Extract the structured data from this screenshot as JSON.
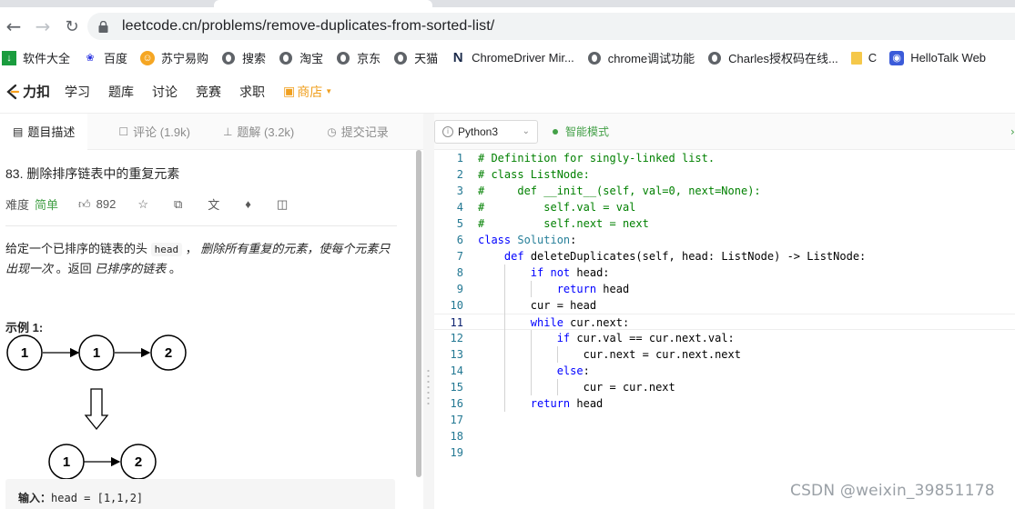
{
  "browser": {
    "url": "leetcode.cn/problems/remove-duplicates-from-sorted-list/"
  },
  "bookmarks": [
    {
      "label": "软件大全",
      "icon": "download-icon",
      "color": "#1a9c3e"
    },
    {
      "label": "百度",
      "icon": "baidu-paw-icon",
      "color": "#2932e1"
    },
    {
      "label": "苏宁易购",
      "icon": "suning-icon",
      "color": "#f5a623"
    },
    {
      "label": "搜索",
      "icon": "globe-icon",
      "color": "#5f6368"
    },
    {
      "label": "淘宝",
      "icon": "globe-icon",
      "color": "#5f6368"
    },
    {
      "label": "京东",
      "icon": "globe-icon",
      "color": "#5f6368"
    },
    {
      "label": "天猫",
      "icon": "globe-icon",
      "color": "#5f6368"
    },
    {
      "label": "ChromeDriver Mir...",
      "icon": "n-logo-icon",
      "color": "#1b2a4a"
    },
    {
      "label": "chrome调试功能",
      "icon": "globe-icon",
      "color": "#5f6368"
    },
    {
      "label": "Charles授权码在线...",
      "icon": "globe-icon",
      "color": "#5f6368"
    },
    {
      "label": "C",
      "icon": "folder-icon",
      "color": "#f5c84a"
    },
    {
      "label": "HelloTalk Web",
      "icon": "hellotalk-icon",
      "color": "#3b5bd9"
    }
  ],
  "nav": {
    "logo": "力扣",
    "items": [
      "学习",
      "题库",
      "讨论",
      "竞赛",
      "求职"
    ],
    "store": "商店"
  },
  "left_tabs": [
    {
      "label": "题目描述",
      "icon": "description-icon",
      "active": true
    },
    {
      "label": "评论 (1.9k)",
      "icon": "comment-icon",
      "active": false
    },
    {
      "label": "题解 (3.2k)",
      "icon": "flask-icon",
      "active": false
    },
    {
      "label": "提交记录",
      "icon": "history-icon",
      "active": false
    }
  ],
  "problem": {
    "title": "83. 删除排序链表中的重复元素",
    "difficulty_label": "难度",
    "difficulty": "简单",
    "likes": "892",
    "desc_1": "给定一个已排序的链表的头 ",
    "desc_code": "head",
    "desc_2": " ， ",
    "desc_em": "删除所有重复的元素，使每个元素只出现一次",
    "desc_3": " 。返回 ",
    "desc_em2": "已排序的链表",
    "desc_4": " 。",
    "example_title": "示例 1:",
    "diagram": {
      "top_row": [
        "1",
        "1",
        "2"
      ],
      "bottom_row": [
        "1",
        "2"
      ]
    },
    "input_label": "输入：",
    "input_value": "head = [1,1,2]"
  },
  "editor": {
    "language": "Python3",
    "mode": "智能模式",
    "current_line": 11,
    "lines": [
      "# Definition for singly-linked list.",
      "# class ListNode:",
      "#     def __init__(self, val=0, next=None):",
      "#         self.val = val",
      "#         self.next = next",
      "class Solution:",
      "    def deleteDuplicates(self, head: ListNode) -> ListNode:",
      "        if not head:",
      "            return head",
      "        cur = head",
      "        while cur.next:",
      "            if cur.val == cur.next.val:",
      "                cur.next = cur.next.next",
      "            else:",
      "                cur = cur.next",
      "        return head",
      "",
      "",
      ""
    ]
  },
  "watermark": "CSDN @weixin_39851178",
  "colors": {
    "easy": "#43a047",
    "store": "#f0a020",
    "comment": "#008000",
    "keyword": "#0000ff",
    "class_name": "#267f99",
    "line_number": "#237893"
  }
}
